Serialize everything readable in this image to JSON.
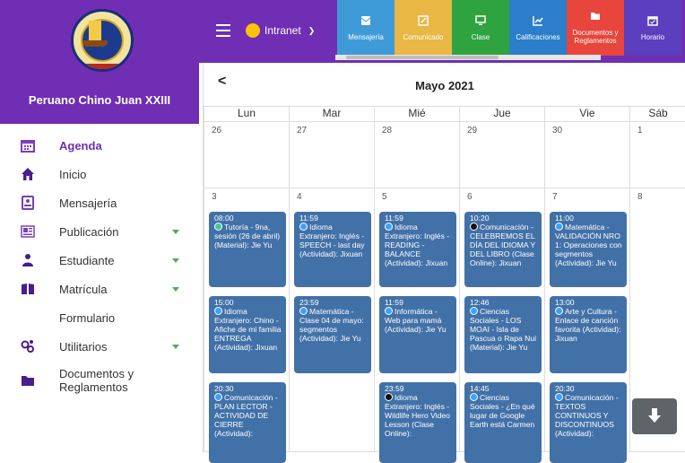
{
  "school_name": "Peruano Chino Juan XXIII",
  "sidebar": {
    "items": [
      {
        "label": "Agenda",
        "icon": "calendar-icon",
        "active": true
      },
      {
        "label": "Inicio",
        "icon": "home-icon"
      },
      {
        "label": "Mensajería",
        "icon": "message-icon"
      },
      {
        "label": "Publicación",
        "icon": "publication-icon",
        "expandable": true
      },
      {
        "label": "Estudiante",
        "icon": "student-icon",
        "expandable": true
      },
      {
        "label": "Matrícula",
        "icon": "enrollment-icon",
        "expandable": true
      },
      {
        "label": "Formulario",
        "icon": ""
      },
      {
        "label": "Utilitarios",
        "icon": "utilities-icon",
        "expandable": true
      },
      {
        "label": "Documentos y Reglamentos",
        "icon": "folder-icon"
      }
    ]
  },
  "topbar": {
    "portal": "Intranet",
    "modules": [
      {
        "label": "Mensajería",
        "color": "#3f9bd8",
        "icon": "envelope-icon"
      },
      {
        "label": "Comunicado",
        "color": "#e8b744",
        "icon": "edit-icon"
      },
      {
        "label": "Clase",
        "color": "#2fa33f",
        "icon": "monitor-icon"
      },
      {
        "label": "Calificaciones",
        "color": "#2b7ec9",
        "icon": "chart-icon"
      },
      {
        "label": "Documentos y Reglamentos",
        "color": "#e8453c",
        "icon": "folder-icon"
      },
      {
        "label": "Horario",
        "color": "#5b3fbf",
        "icon": "schedule-icon"
      }
    ]
  },
  "calendar": {
    "month": "Mayo 2021",
    "prev": "<",
    "days": [
      "Lun",
      "Mar",
      "Mié",
      "Jue",
      "Vie",
      "Sáb"
    ],
    "week1": [
      "26",
      "27",
      "28",
      "29",
      "30",
      "1"
    ],
    "week2": [
      "3",
      "4",
      "5",
      "6",
      "7",
      "8"
    ]
  },
  "events": [
    {
      "col": 0,
      "row": 0,
      "time": "08:00",
      "dot": "green",
      "text": "Tutoría - 9na, sesión (26 de abril) (Material): Jie Yu"
    },
    {
      "col": 0,
      "row": 1,
      "time": "15:00",
      "dot": "blue",
      "text": "Idioma Extranjero: Chino - Afiche de mi familia ENTREGA (Actividad): Jixuan"
    },
    {
      "col": 0,
      "row": 2,
      "time": "20:30",
      "dot": "blue",
      "text": "Comunicación - PLAN LECTOR - ACTIVIDAD DE CIERRE (Actividad):"
    },
    {
      "col": 1,
      "row": 0,
      "time": "11:59",
      "dot": "blue",
      "text": "Idioma Extranjero: Inglés - SPEECH - last day (Actividad): Jixuan"
    },
    {
      "col": 1,
      "row": 1,
      "time": "23:59",
      "dot": "blue",
      "text": "Matemática - Clase 04 de mayo: segmentos (Actividad): Jie Yu"
    },
    {
      "col": 2,
      "row": 0,
      "time": "11:59",
      "dot": "blue",
      "text": "Idioma Extranjero: Inglés - READING - BALANCE (Actividad): Jixuan"
    },
    {
      "col": 2,
      "row": 1,
      "time": "11:59",
      "dot": "blue",
      "text": "Informática - Web para mamá (Actividad): Jie Yu"
    },
    {
      "col": 2,
      "row": 2,
      "time": "23:59",
      "dot": "black",
      "text": "Idioma Extranjero: Inglés - Wildlife Hero Video Lesson (Clase Online):"
    },
    {
      "col": 3,
      "row": 0,
      "time": "10:20",
      "dot": "black",
      "text": "Comunicación - CELEBREMOS EL DÍA DEL IDIOMA Y DEL LIBRO (Clase Online): Jixuan"
    },
    {
      "col": 3,
      "row": 1,
      "time": "12:46",
      "dot": "blue",
      "text": "Ciencias Sociales - LOS MOAI - Isla de Pascua o Rapa Nui (Material): Jie Yu"
    },
    {
      "col": 3,
      "row": 2,
      "time": "14:45",
      "dot": "blue",
      "text": "Ciencias Sociales - ¿En qué lugar de Google Earth está Carmen"
    },
    {
      "col": 4,
      "row": 0,
      "time": "11:00",
      "dot": "blue",
      "text": "Matemática - VALIDACIÓN NRO 1: Operaciones con segmentos (Actividad): Jie Yu"
    },
    {
      "col": 4,
      "row": 1,
      "time": "13:00",
      "dot": "blue",
      "text": "Arte y Cultura - Enlace de canción favorita (Actividad): Jixuan"
    },
    {
      "col": 4,
      "row": 2,
      "time": "20:30",
      "dot": "blue",
      "text": "Comunicación - TEXTOS CONTINUOS Y DISCONTINUOS (Actividad):"
    }
  ]
}
